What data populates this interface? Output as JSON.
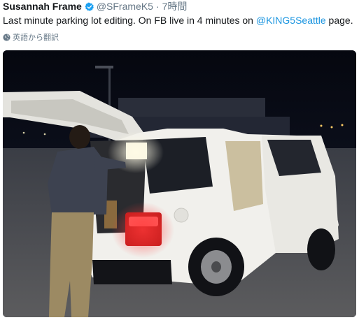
{
  "tweet": {
    "author_name": "Susannah Frame",
    "handle": "@SFrameK5",
    "separator": "·",
    "time": "7時間",
    "text_before": "Last minute parking lot editing. On FB live in 4 minutes on ",
    "mention": "@KING5Seattle",
    "text_after": " page.",
    "translate_label": "英語から翻訳",
    "verified_icon": "verified-badge-icon",
    "globe_icon": "globe-icon"
  },
  "colors": {
    "name": "#14171a",
    "meta": "#657786",
    "link": "#1b95e0",
    "verified": "#1da1f2"
  }
}
